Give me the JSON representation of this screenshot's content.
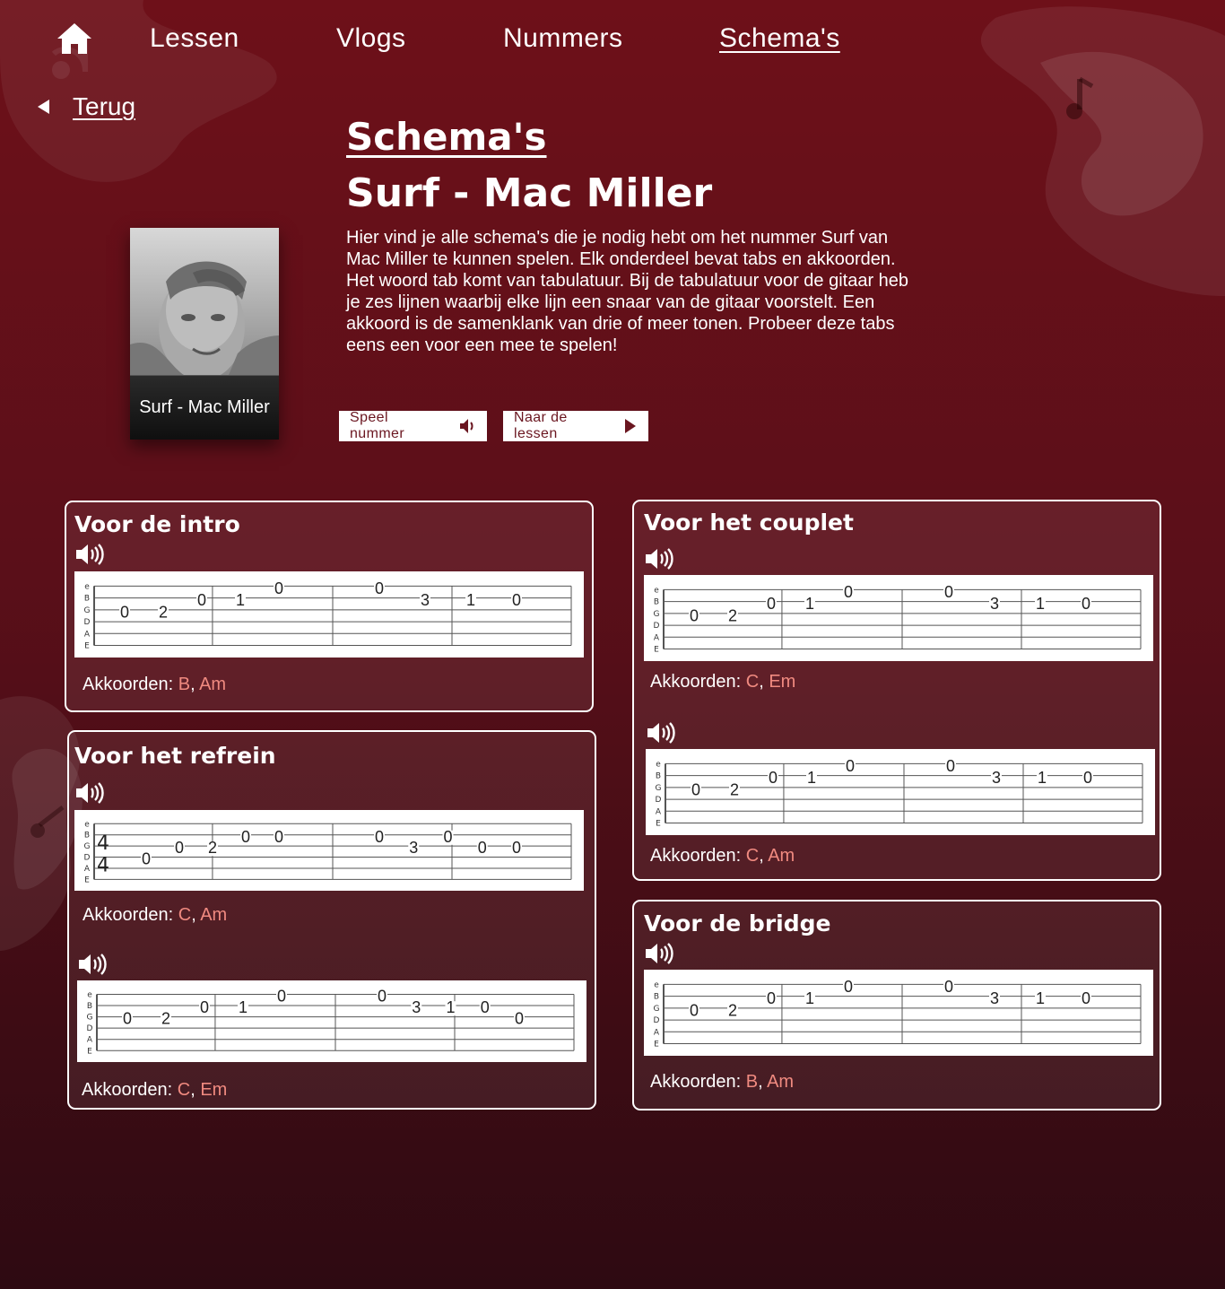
{
  "nav": {
    "items": [
      {
        "label": "Lessen"
      },
      {
        "label": "Vlogs"
      },
      {
        "label": "Nummers"
      },
      {
        "label": "Schema's"
      }
    ]
  },
  "back_label": "Terug",
  "page_title": "Schema's",
  "song_title": "Surf - Mac Miller",
  "intro_text": "Hier vind je alle schema's die je nodig hebt om het nummer Surf van Mac Miller te kunnen spelen. Elk onderdeel bevat tabs en akkoorden. Het woord tab komt van tabulatuur. Bij de tabulatuur voor de gitaar heb je zes lijnen waarbij elke lijn een snaar van de gitaar voorstelt. Een akkoord is de samenklank van drie of meer tonen. Probeer deze tabs eens een voor een mee te spelen!",
  "album": {
    "caption": "Surf - Mac Miller"
  },
  "buttons": {
    "play_song": "Speel nummer",
    "to_lessons": "Naar de lessen"
  },
  "chords_label": "Akkoorden:",
  "string_names": [
    "e",
    "B",
    "G",
    "D",
    "A",
    "E"
  ],
  "time_signature": [
    "4",
    "4"
  ],
  "colors": {
    "accent": "#f08a80",
    "background": "#5a0f19",
    "button_text": "#6a1620"
  },
  "sections": {
    "intro": {
      "title": "Voor de intro",
      "tabs": [
        {
          "chords": [
            "B",
            "Am"
          ],
          "notes": [
            {
              "s": 3,
              "f": "0"
            },
            {
              "s": 3,
              "f": "2"
            },
            {
              "s": 2,
              "f": "0"
            },
            {
              "s": 2,
              "f": "1"
            },
            {
              "s": 1,
              "f": "0"
            },
            {
              "s": 1,
              "f": "0"
            },
            {
              "s": 2,
              "f": "3"
            },
            {
              "s": 2,
              "f": "1"
            },
            {
              "s": 2,
              "f": "0"
            }
          ]
        }
      ]
    },
    "refrein": {
      "title": "Voor het refrein",
      "tabs": [
        {
          "chords": [
            "C",
            "Am"
          ],
          "time_signature": true,
          "notes": [
            {
              "s": 4,
              "f": "0"
            },
            {
              "s": 3,
              "f": "0"
            },
            {
              "s": 3,
              "f": "2"
            },
            {
              "s": 2,
              "f": "0"
            },
            {
              "s": 2,
              "f": "0"
            },
            {
              "s": 2,
              "f": "0"
            },
            {
              "s": 3,
              "f": "3"
            },
            {
              "s": 2,
              "f": "0"
            },
            {
              "s": 3,
              "f": "0"
            },
            {
              "s": 3,
              "f": "0"
            }
          ]
        },
        {
          "chords": [
            "C",
            "Em"
          ],
          "notes": [
            {
              "s": 3,
              "f": "0"
            },
            {
              "s": 3,
              "f": "2"
            },
            {
              "s": 2,
              "f": "0"
            },
            {
              "s": 2,
              "f": "1"
            },
            {
              "s": 1,
              "f": "0"
            },
            {
              "s": 1,
              "f": "0"
            },
            {
              "s": 2,
              "f": "3"
            },
            {
              "s": 2,
              "f": "1"
            },
            {
              "s": 2,
              "f": "0"
            },
            {
              "s": 3,
              "f": "0"
            }
          ]
        }
      ]
    },
    "couplet": {
      "title": "Voor het couplet",
      "tabs": [
        {
          "chords": [
            "C",
            "Em"
          ],
          "notes": [
            {
              "s": 3,
              "f": "0"
            },
            {
              "s": 3,
              "f": "2"
            },
            {
              "s": 2,
              "f": "0"
            },
            {
              "s": 2,
              "f": "1"
            },
            {
              "s": 1,
              "f": "0"
            },
            {
              "s": 1,
              "f": "0"
            },
            {
              "s": 2,
              "f": "3"
            },
            {
              "s": 2,
              "f": "1"
            },
            {
              "s": 2,
              "f": "0"
            }
          ]
        },
        {
          "chords": [
            "C",
            "Am"
          ],
          "notes": [
            {
              "s": 3,
              "f": "0"
            },
            {
              "s": 3,
              "f": "2"
            },
            {
              "s": 2,
              "f": "0"
            },
            {
              "s": 2,
              "f": "1"
            },
            {
              "s": 1,
              "f": "0"
            },
            {
              "s": 1,
              "f": "0"
            },
            {
              "s": 2,
              "f": "3"
            },
            {
              "s": 2,
              "f": "1"
            },
            {
              "s": 2,
              "f": "0"
            }
          ]
        }
      ]
    },
    "bridge": {
      "title": "Voor de bridge",
      "tabs": [
        {
          "chords": [
            "B",
            "Am"
          ],
          "notes": [
            {
              "s": 3,
              "f": "0"
            },
            {
              "s": 3,
              "f": "2"
            },
            {
              "s": 2,
              "f": "0"
            },
            {
              "s": 2,
              "f": "1"
            },
            {
              "s": 1,
              "f": "0"
            },
            {
              "s": 1,
              "f": "0"
            },
            {
              "s": 2,
              "f": "3"
            },
            {
              "s": 2,
              "f": "1"
            },
            {
              "s": 2,
              "f": "0"
            }
          ]
        }
      ]
    }
  }
}
